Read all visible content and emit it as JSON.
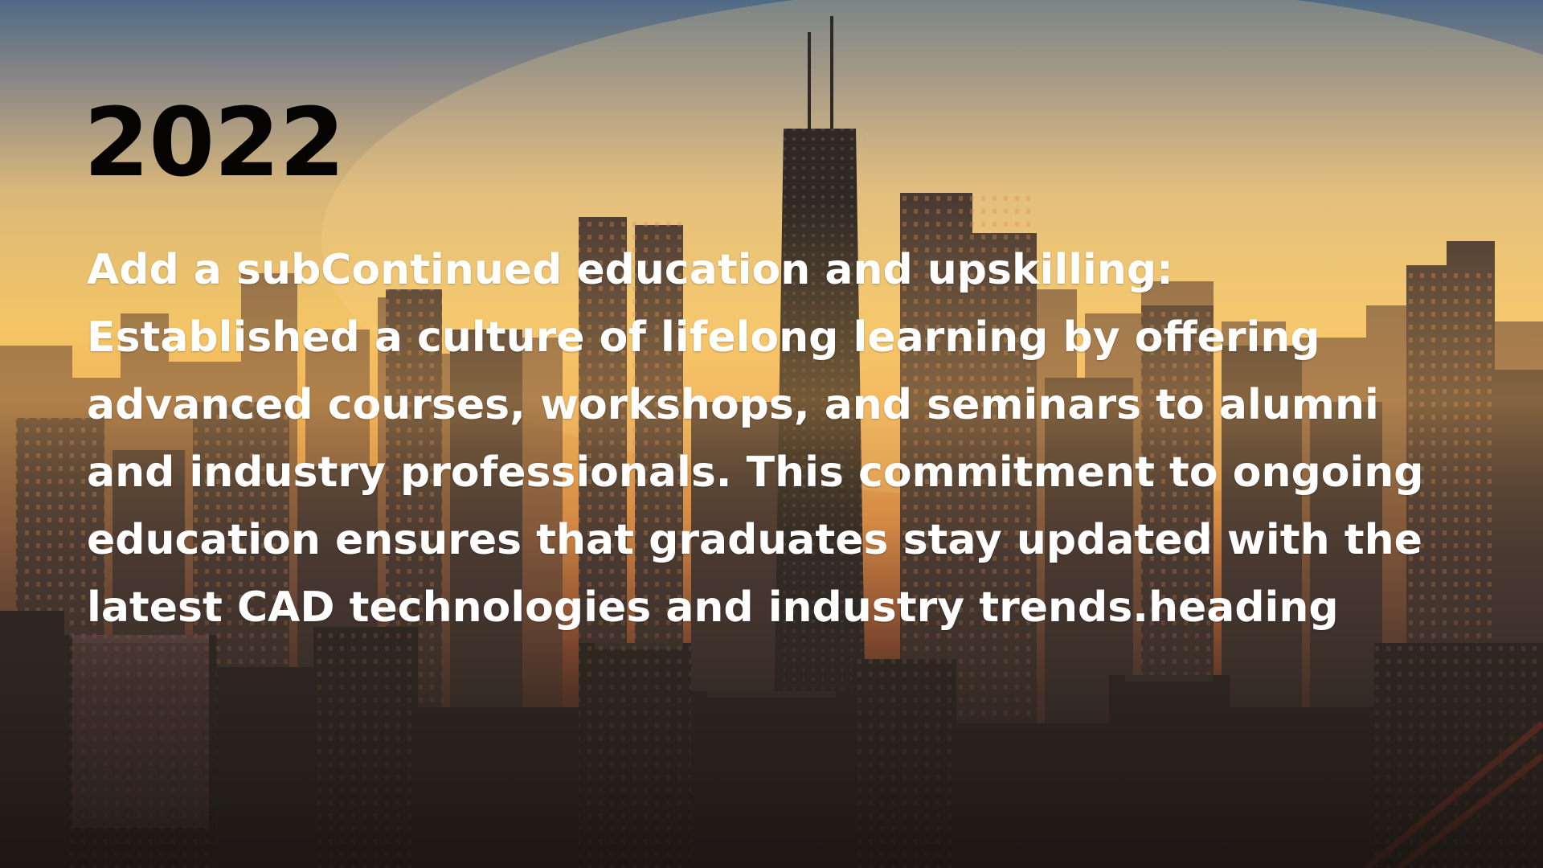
{
  "slide": {
    "year": "2022",
    "body_lines": [
      "Add a subContinued education and upskilling:",
      "Established a culture of lifelong learning by offering",
      "advanced courses, workshops, and seminars to alumni",
      "and industry professionals. This commitment to ongoing",
      "education ensures that graduates stay updated with the",
      "latest CAD technologies and industry trends.heading"
    ],
    "background": {
      "subject": "city-skyline-at-sunset",
      "colors": {
        "sky_top": "#5a6e86",
        "sky_glow": "#f3c56a",
        "horizon": "#e88a3a",
        "buildings_dark": "#2b2521",
        "buildings_mid": "#4a3b33",
        "windows_warm": "#d98a4f"
      }
    },
    "colors": {
      "year_text": "#050403",
      "body_text": "#ffffff"
    }
  }
}
